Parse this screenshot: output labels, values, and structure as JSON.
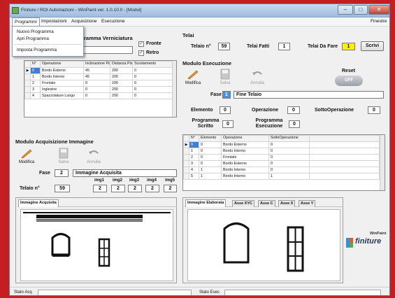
{
  "window": {
    "title": "Finiture / ROI Automazioni - WinPaint ver. 1.0.10.0 - [Modul]",
    "btn_min": "–",
    "btn_max": "□",
    "btn_close": "✕"
  },
  "menu": {
    "items": [
      "Programmi",
      "Impostazioni",
      "Acquisizione",
      "Esecuzione"
    ],
    "right": "Finestre"
  },
  "dropdown": [
    "Nuovo Programma",
    "Apri Programma",
    "Imposta Programma"
  ],
  "verniciatura": {
    "title": "ramma Verniciatura",
    "fronte_label": "Fronte",
    "fronte_checked": true,
    "retro_label": "Retro",
    "retro_checked": true,
    "columns": [
      "N°",
      "Operazione",
      "Inclinazione Pistola",
      "Distanza Pistola",
      "Scostamento"
    ],
    "rows": [
      [
        "0",
        "Bordo Esterno",
        "45",
        "200",
        "0"
      ],
      [
        "1",
        "Bordo Interno",
        "45",
        "200",
        "0"
      ],
      [
        "2",
        "Frontale",
        "0",
        "200",
        "0"
      ],
      [
        "3",
        "Inglesine",
        "0",
        "200",
        "0"
      ],
      [
        "4",
        "Spazzolature Lungo",
        "0",
        "200",
        "0"
      ]
    ]
  },
  "telai": {
    "title": "Telai",
    "telaio_label": "Telaio n°",
    "telaio_value": "59",
    "fatti_label": "Telai Fatti",
    "fatti_value": "1",
    "da_fare_label": "Telai Da Fare",
    "da_fare_value": "1",
    "scrivi": "Scrivi"
  },
  "esecuzione": {
    "title": "Modulo Esecuzione",
    "tools": [
      "Modifica",
      "Salva",
      "Annulla"
    ],
    "reset_label": "Reset",
    "reset_state": "OFF",
    "fase_label": "Fase",
    "fase_num": "1",
    "fase_name": "Fine Telaio",
    "elemento_label": "Elemento",
    "elemento_value": "0",
    "operazione_label": "Operazione",
    "operazione_value": "0",
    "sottooperazione_label": "SottoOperazione",
    "sottooperazione_value": "0",
    "prog_scritto_label": "Programma Scritto",
    "prog_scritto_value": "0",
    "prog_esecuzione_label": "Programma Esecuzione",
    "prog_esecuzione_value": "0",
    "columns": [
      "N°",
      "Elemento",
      "Operazione",
      "SottoOperazione"
    ],
    "rows": [
      [
        "0",
        "0",
        "Bordo Esterno",
        "0"
      ],
      [
        "1",
        "0",
        "Bordo Interno",
        "0"
      ],
      [
        "2",
        "0",
        "Frontale",
        "0"
      ],
      [
        "3",
        "0",
        "Bordo Esterno",
        "0"
      ],
      [
        "4",
        "1",
        "Bordo Interno",
        "0"
      ],
      [
        "5",
        "1",
        "Bordo Interno",
        "1"
      ]
    ]
  },
  "acquisizione": {
    "title": "Modulo Acquisizione Immagine",
    "tools": [
      "Modifica",
      "Salva",
      "Annulla"
    ],
    "fase_label": "Fase",
    "fase_num": "2",
    "fase_name": "Immagine Acquisita",
    "telaio_label": "Telaio n°",
    "telaio_value": "59",
    "img_labels": [
      "img1",
      "img2",
      "img3",
      "img4",
      "img5"
    ],
    "img_values": [
      "2",
      "2",
      "2",
      "2",
      "2"
    ]
  },
  "immagine_acquisita": {
    "title": "Immagine Acquisita"
  },
  "elaborata_tabs": [
    "Immagine Elaborata",
    "Asse XYC",
    "Asse C",
    "Asse X",
    "Asse Y"
  ],
  "logo": {
    "brand": "finiture",
    "product": "WinPaint"
  },
  "status": {
    "acq_label": "Stato Acq",
    "esec_label": "Stato Esec"
  },
  "colors": {
    "accent_yellow": "#ffef00",
    "background_red": "#c41d22"
  }
}
